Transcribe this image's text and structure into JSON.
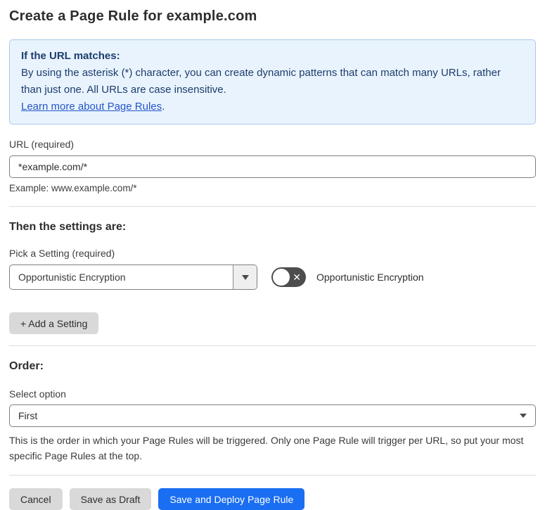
{
  "page": {
    "title": "Create a Page Rule for example.com"
  },
  "info_box": {
    "heading": "If the URL matches:",
    "body": "By using the asterisk (*) character, you can create dynamic patterns that can match many URLs, rather than just one. All URLs are case insensitive.",
    "link_label": "Learn more about Page Rules",
    "link_suffix": "."
  },
  "url_field": {
    "label": "URL (required)",
    "value": "*example.com/*",
    "helper": "Example: www.example.com/*"
  },
  "settings_section": {
    "heading": "Then the settings are:",
    "picker_label": "Pick a Setting (required)",
    "picker_value": "Opportunistic Encryption",
    "toggle": {
      "state": "off",
      "icon": "x-icon",
      "label": "Opportunistic Encryption"
    },
    "add_button_label": "+ Add a Setting"
  },
  "order_section": {
    "heading": "Order:",
    "select_label": "Select option",
    "select_value": "First",
    "helper": "This is the order in which your Page Rules will be triggered. Only one Page Rule will trigger per URL, so put your most specific Page Rules at the top."
  },
  "footer": {
    "cancel_label": "Cancel",
    "save_draft_label": "Save as Draft",
    "save_deploy_label": "Save and Deploy Page Rule"
  },
  "colors": {
    "info_background": "#e9f3fd",
    "info_border": "#abc9e9",
    "info_text": "#1c3d6e",
    "link_blue": "#2456c8",
    "primary_button_blue": "#1a6ef2",
    "gray_button": "#d9d9d9",
    "toggle_off_gray": "#4d4d4d"
  }
}
